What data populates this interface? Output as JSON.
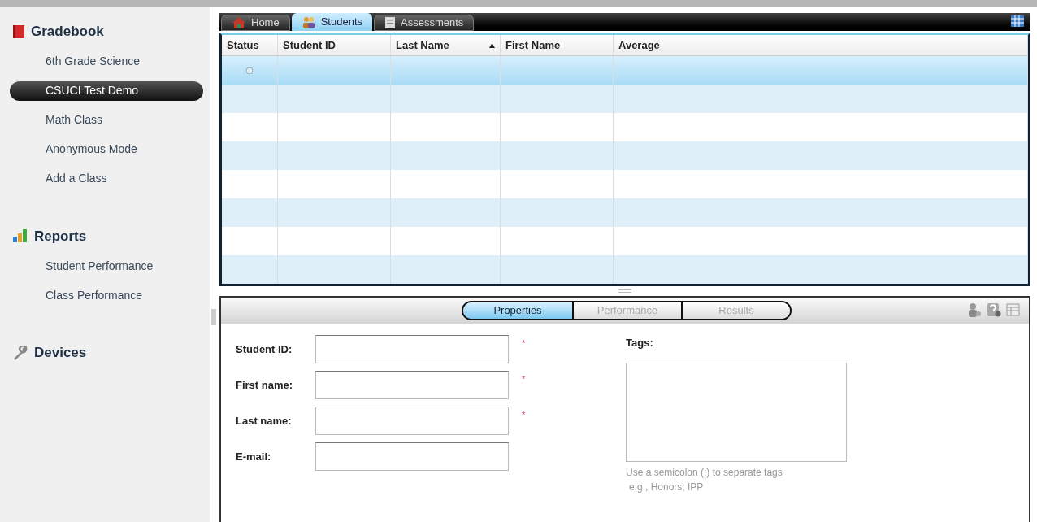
{
  "sidebar": {
    "sections": [
      {
        "kind": "gradebook",
        "title": "Gradebook",
        "items": [
          {
            "label": "6th Grade Science",
            "selected": false
          },
          {
            "label": "CSUCI Test Demo",
            "selected": true
          },
          {
            "label": "Math Class",
            "selected": false
          },
          {
            "label": "Anonymous Mode",
            "selected": false
          },
          {
            "label": "Add a Class",
            "selected": false
          }
        ]
      },
      {
        "kind": "reports",
        "title": "Reports",
        "items": [
          {
            "label": "Student Performance",
            "selected": false
          },
          {
            "label": "Class Performance",
            "selected": false
          }
        ]
      },
      {
        "kind": "devices",
        "title": "Devices"
      }
    ]
  },
  "tabs": [
    {
      "kind": "home",
      "label": "Home",
      "selected": false
    },
    {
      "kind": "students",
      "label": "Students",
      "selected": true
    },
    {
      "kind": "assessments",
      "label": "Assessments",
      "selected": false
    }
  ],
  "table": {
    "columns": [
      {
        "label": "Status",
        "sorted": false
      },
      {
        "label": "Student ID",
        "sorted": false
      },
      {
        "label": "Last Name",
        "sorted": true
      },
      {
        "label": "First Name",
        "sorted": false
      },
      {
        "label": "Average",
        "sorted": false
      }
    ],
    "rows": [
      {
        "selected": true
      },
      {
        "selected": false
      },
      {
        "selected": false
      },
      {
        "selected": false
      },
      {
        "selected": false
      },
      {
        "selected": false
      },
      {
        "selected": false
      },
      {
        "selected": false
      }
    ]
  },
  "detail_tabs": [
    {
      "label": "Properties",
      "selected": true
    },
    {
      "label": "Performance",
      "selected": false
    },
    {
      "label": "Results",
      "selected": false
    }
  ],
  "form": {
    "fields": [
      {
        "label": "Student ID:",
        "required": true
      },
      {
        "label": "First name:",
        "required": true
      },
      {
        "label": "Last name:",
        "required": true
      },
      {
        "label": "E-mail:",
        "required": false
      }
    ],
    "required_mark": "*",
    "tags": {
      "label": "Tags:",
      "hint": "Use a semicolon (;) to separate tags",
      "example": "e.g., Honors; IPP"
    }
  }
}
